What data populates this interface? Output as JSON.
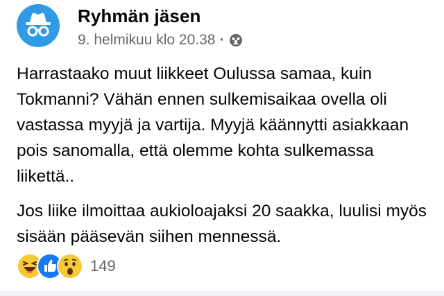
{
  "post": {
    "author": "Ryhmän jäsen",
    "timestamp": "9. helmikuu klo 20.38",
    "separator": "·",
    "privacy_icon": "group-icon",
    "avatar_icon": "anonymous-incognito-icon",
    "paragraphs": [
      "Harrastaako muut liikkeet Oulussa samaa, kuin Tokmanni? Vähän ennen sulkemisaikaa ovella oli vastassa myyjä ja vartija. Myyjä käännytti asiakkaan pois sanomalla, että olemme kohta sulkemassa liikettä..",
      "Jos liike ilmoittaa aukioloajaksi 20 saakka, luulisi myös sisään pääsevän siihen mennessä."
    ]
  },
  "reactions": {
    "icons": [
      "haha-icon",
      "like-icon",
      "wow-icon"
    ],
    "count": "149"
  },
  "colors": {
    "avatar_bg": "#2f9ae6",
    "like_blue": "#1877f2",
    "emoji_yellow": "#f7c934",
    "secondary_text": "#65676b"
  }
}
